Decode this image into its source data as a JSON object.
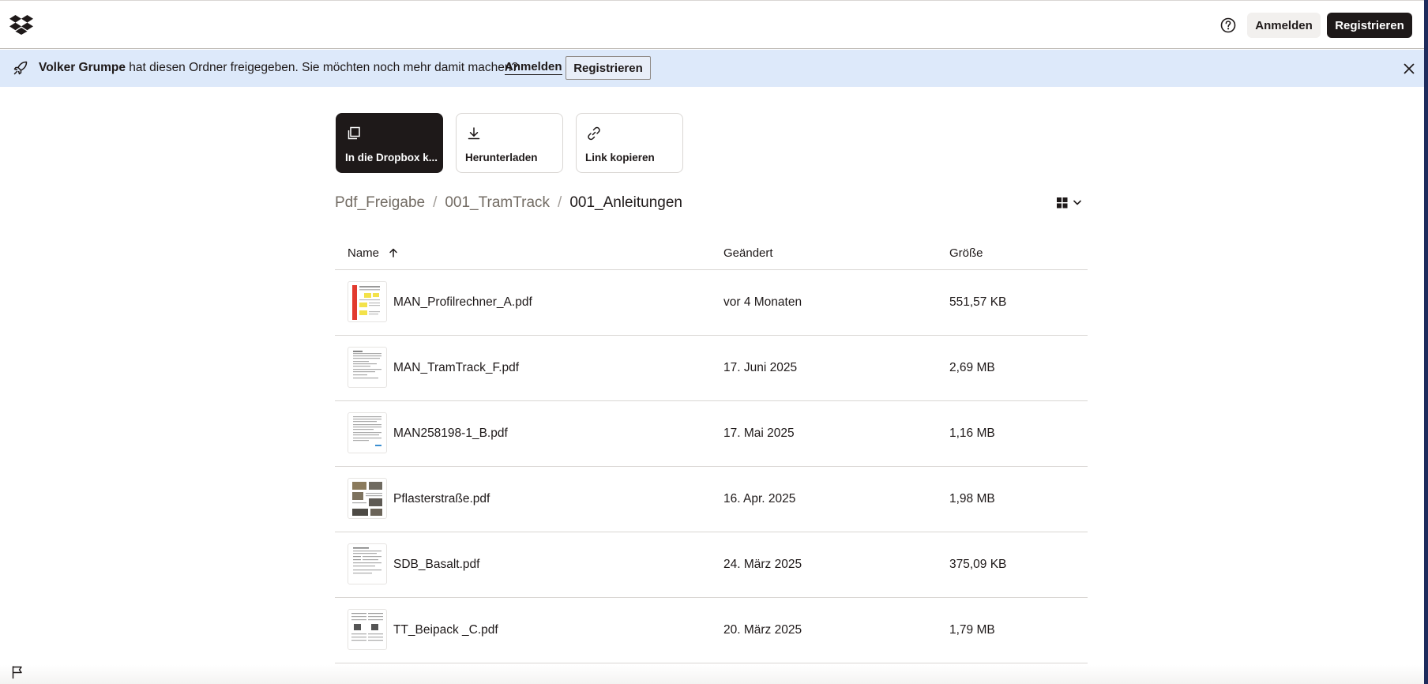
{
  "topbar": {
    "login_label": "Anmelden",
    "register_label": "Registrieren"
  },
  "banner": {
    "owner": "Volker Grumpe",
    "message": " hat diesen Ordner freigegeben. Sie möchten noch mehr damit machen?",
    "login_label": "Anmelden",
    "register_label": "Registrieren",
    "bg_color": "#dde9fa"
  },
  "actions": [
    {
      "label": "In die Dropbox k...",
      "icon": "copy-icon"
    },
    {
      "label": "Herunterladen",
      "icon": "download-icon"
    },
    {
      "label": "Link kopieren",
      "icon": "link-icon"
    }
  ],
  "breadcrumb": [
    "Pdf_Freigabe",
    "001_TramTrack",
    "001_Anleitungen"
  ],
  "table": {
    "columns": [
      "Name",
      "Geändert",
      "Größe"
    ],
    "sort": "Name ascending",
    "rows": [
      {
        "name": "MAN_Profilrechner_A.pdf",
        "modified": "vor 4 Monaten",
        "size": "551,57 KB"
      },
      {
        "name": "MAN_TramTrack_F.pdf",
        "modified": "17. Juni 2025",
        "size": "2,69 MB"
      },
      {
        "name": "MAN258198-1_B.pdf",
        "modified": "17. Mai 2025",
        "size": "1,16 MB"
      },
      {
        "name": "Pflasterstraße.pdf",
        "modified": "16. Apr. 2025",
        "size": "1,98 MB"
      },
      {
        "name": "SDB_Basalt.pdf",
        "modified": "24. März 2025",
        "size": "375,09 KB"
      },
      {
        "name": "TT_Beipack _C.pdf",
        "modified": "20. März 2025",
        "size": "1,79 MB"
      }
    ]
  },
  "colors": {
    "primary_dark": "#1e1919",
    "accent_strip": "#1e2b5c"
  }
}
